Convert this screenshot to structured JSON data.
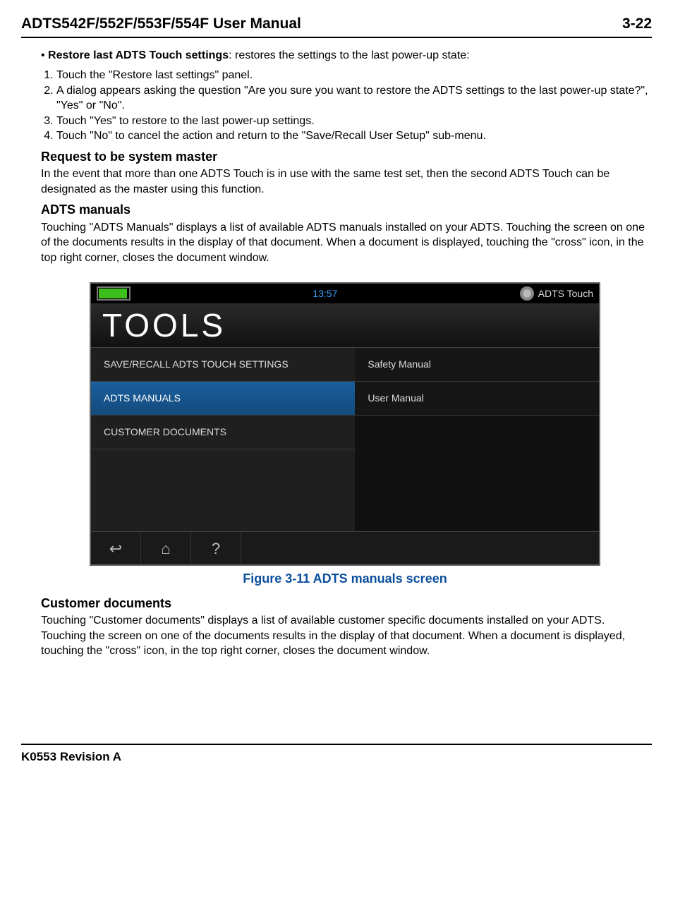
{
  "header": {
    "title": "ADTS542F/552F/553F/554F User Manual",
    "page": "3-22"
  },
  "bullet": {
    "title": "Restore last ADTS Touch settings",
    "desc": ": restores the settings to the last power-up state:"
  },
  "steps": [
    "Touch the \"Restore last settings\" panel.",
    "A dialog appears asking the question \"Are you sure you want to restore the ADTS settings to the last power-up state?\", \"Yes\" or \"No\".",
    "Touch \"Yes\" to restore to the last power-up settings.",
    "Touch \"No\" to cancel the action and return to the \"Save/Recall User Setup\" sub-menu."
  ],
  "sections": {
    "request_master": {
      "heading": "Request to be system master",
      "body": "In the event that more than one ADTS Touch is in use with the same test set, then the second ADTS Touch can be designated as the master using this function."
    },
    "adts_manuals": {
      "heading": "ADTS manuals",
      "body": "Touching \"ADTS Manuals\" displays a list of available ADTS manuals installed on your ADTS. Touching the screen on one of the documents results in the display of that document. When a document is displayed, touching the \"cross\" icon, in the top right corner, closes the document window."
    },
    "customer_docs": {
      "heading": "Customer documents",
      "body": "Touching \"Customer documents\" displays a list of available customer specific documents installed on your ADTS. Touching the screen on one of the documents results in the display of that document. When a document is displayed, touching the \"cross\" icon, in the top right corner, closes the document window."
    }
  },
  "figure": {
    "caption": "Figure 3-11 ADTS manuals screen"
  },
  "device": {
    "clock": "13:57",
    "brand": "ADTS Touch",
    "tools_label": "TOOLS",
    "left_menu": {
      "item1": "SAVE/RECALL ADTS TOUCH SETTINGS",
      "item2": "ADTS MANUALS",
      "item3": "CUSTOMER DOCUMENTS"
    },
    "right_menu": {
      "item1": "Safety Manual",
      "item2": "User Manual"
    },
    "nav": {
      "back": "↩",
      "home": "⌂",
      "help": "?"
    }
  },
  "footer": {
    "revision": "K0553 Revision A"
  }
}
